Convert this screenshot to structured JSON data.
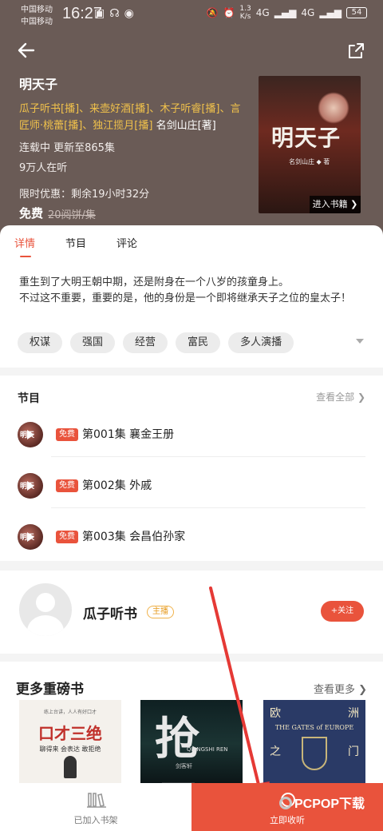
{
  "status_bar": {
    "carrier1": "中国移动",
    "carrier2": "中国移动",
    "time": "16:27",
    "speed": "1.3\nK/s",
    "signal1": "4G",
    "signal2": "4G",
    "battery": "54"
  },
  "book": {
    "title": "明天子",
    "narrators": [
      "瓜子听书[播]、",
      "来壶好酒[播]、",
      "木子听睿[播]、",
      "言匠师·桃蕾[播]、",
      "独江揽月[播]"
    ],
    "author": "名剑山庄[著]",
    "status": "连载中  更新至865集",
    "listeners": "9万人在听",
    "promo": "限时优惠：剩余19小时32分",
    "price_free": "免费",
    "price_old": "20阅饼/集",
    "cover_title": "明天子",
    "cover_author": "名剑山庄 ◆ 著",
    "cover_enter": "进入书籍 ❯"
  },
  "tabs": [
    {
      "label": "详情",
      "active": true
    },
    {
      "label": "节目",
      "active": false
    },
    {
      "label": "评论",
      "active": false
    }
  ],
  "description": "重生到了大明王朝中期，还是附身在一个八岁的孩童身上。\n不过这不重要，重要的是，他的身份是一个即将继承天子之位的皇太子！",
  "tags": [
    "权谋",
    "强国",
    "经营",
    "富民",
    "多人演播"
  ],
  "episodes": {
    "title": "节目",
    "see_all": "查看全部 ❯",
    "free_label": "免费",
    "thumb_text": "明天",
    "items": [
      {
        "title": "第001集 襄金王册"
      },
      {
        "title": "第002集 外戚"
      },
      {
        "title": "第003集 会昌伯孙家"
      }
    ]
  },
  "anchor": {
    "name": "瓜子听书",
    "role": "主播",
    "follow": "+关注"
  },
  "more_books": {
    "title": "更多重磅书",
    "see_more": "查看更多 ❯",
    "book1": {
      "top": "练上台讲，人人有好口才",
      "title": "口才三绝",
      "sub": "聊得来  会表达  敢拒绝"
    },
    "book2": {
      "big": "抢尸",
      "en": "QIANGSHI REN",
      "sub": "剑客轩"
    },
    "book3": {
      "c1": "欧",
      "c2": "洲",
      "gates": "THE GATES of EUROPE",
      "c3": "之",
      "c4": "门"
    }
  },
  "bottom_bar": {
    "shelf_label": "已加入书架",
    "listen_label": "立即收听"
  },
  "watermark": "PCPOP下载",
  "colors": {
    "accent": "#e9533c",
    "header_bg": "#6a5b56",
    "narrator_gold": "#f0c14b"
  }
}
